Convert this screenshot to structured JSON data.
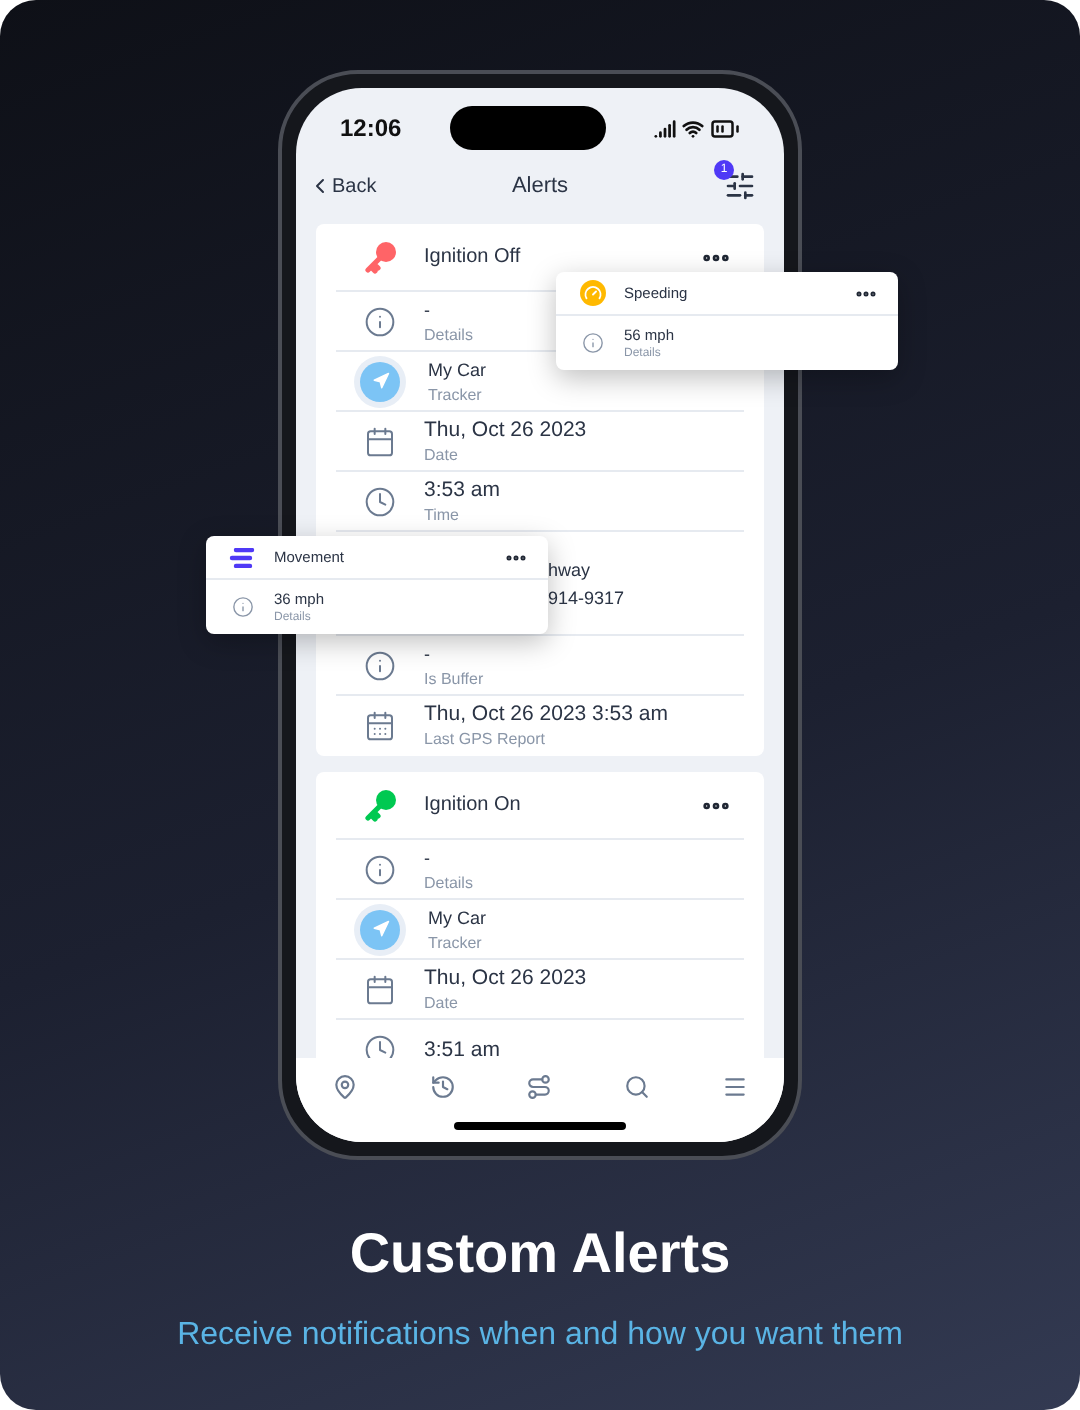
{
  "status_bar": {
    "time": "12:06"
  },
  "nav": {
    "back": "Back",
    "title": "Alerts",
    "filter_badge": "1"
  },
  "alerts": [
    {
      "title": "Ignition Off",
      "kind": "off",
      "rows": [
        {
          "kind": "info",
          "value": "-",
          "label": "Details"
        },
        {
          "kind": "tracker",
          "value": "My Car",
          "label": "Tracker"
        },
        {
          "kind": "date",
          "value": "Thu, Oct 26 2023",
          "label": "Date"
        },
        {
          "kind": "time",
          "value": "3:53 am",
          "label": "Time"
        },
        {
          "kind": "address",
          "value": "hway",
          "value_2": "914-9317"
        },
        {
          "kind": "info",
          "value": "-",
          "label": "Is Buffer"
        },
        {
          "kind": "gps",
          "value": "Thu, Oct 26 2023 3:53 am",
          "label": "Last GPS Report"
        }
      ]
    },
    {
      "title": "Ignition On",
      "kind": "on",
      "rows": [
        {
          "kind": "info",
          "value": "-",
          "label": "Details"
        },
        {
          "kind": "tracker",
          "value": "My Car",
          "label": "Tracker"
        },
        {
          "kind": "date",
          "value": "Thu, Oct 26 2023",
          "label": "Date"
        },
        {
          "kind": "time",
          "value": "3:51 am"
        }
      ]
    }
  ],
  "popups": [
    {
      "kind": "speeding",
      "title": "Speeding",
      "value": "56 mph",
      "label": "Details"
    },
    {
      "kind": "movement",
      "title": "Movement",
      "value": "36 mph",
      "label": "Details"
    }
  ],
  "footer": {
    "title": "Custom Alerts",
    "subtitle": "Receive notifications when and how you want them"
  }
}
